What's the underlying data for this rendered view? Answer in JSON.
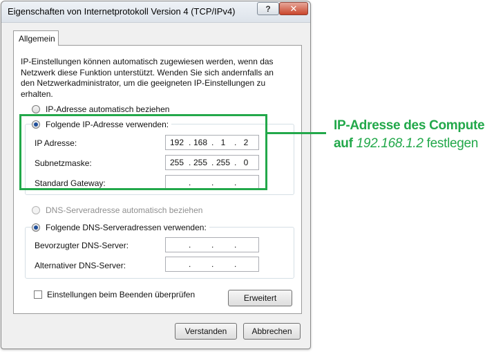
{
  "window": {
    "title": "Eigenschaften von Internetprotokoll Version 4 (TCP/IPv4)",
    "help_label": "?",
    "close_label": "✕"
  },
  "tab": {
    "label": "Allgemein"
  },
  "description": "IP-Einstellungen können automatisch zugewiesen werden, wenn das\nNetzwerk diese Funktion unterstützt. Wenden Sie sich andernfalls an\nden Netzwerkadministrator, um die geeigneten IP-Einstellungen zu\nerhalten.",
  "ip_mode": {
    "auto_label": "IP-Adresse automatisch beziehen",
    "manual_label": "Folgende IP-Adresse verwenden:",
    "selected": "manual"
  },
  "ip_fields": {
    "ip_label": "IP Adresse:",
    "ip_octets": [
      "192",
      "168",
      "1",
      "2"
    ],
    "subnet_label": "Subnetzmaske:",
    "subnet_octets": [
      "255",
      "255",
      "255",
      "0"
    ],
    "gateway_label": "Standard Gateway:",
    "gateway_octets": [
      "",
      "",
      "",
      ""
    ]
  },
  "dns_mode": {
    "auto_label": "DNS-Serveradresse automatisch beziehen",
    "manual_label": "Folgende DNS-Serveradressen verwenden:",
    "selected": "manual"
  },
  "dns_fields": {
    "preferred_label": "Bevorzugter DNS-Server:",
    "alternate_label": "Alternativer DNS-Server:"
  },
  "validate_label": "Einstellungen beim Beenden überprüfen",
  "advanced_label": "Erweitert",
  "ok_label": "Verstanden",
  "cancel_label": "Abbrechen",
  "annotation": {
    "line1": "IP-Adresse des Computers",
    "line2_prefix": "auf",
    "line2_ip": "192.168.1.2",
    "line2_suffix": "festlegen"
  },
  "colors": {
    "annotation": "#22a84a",
    "radio_dot": "#1f4f9a"
  }
}
